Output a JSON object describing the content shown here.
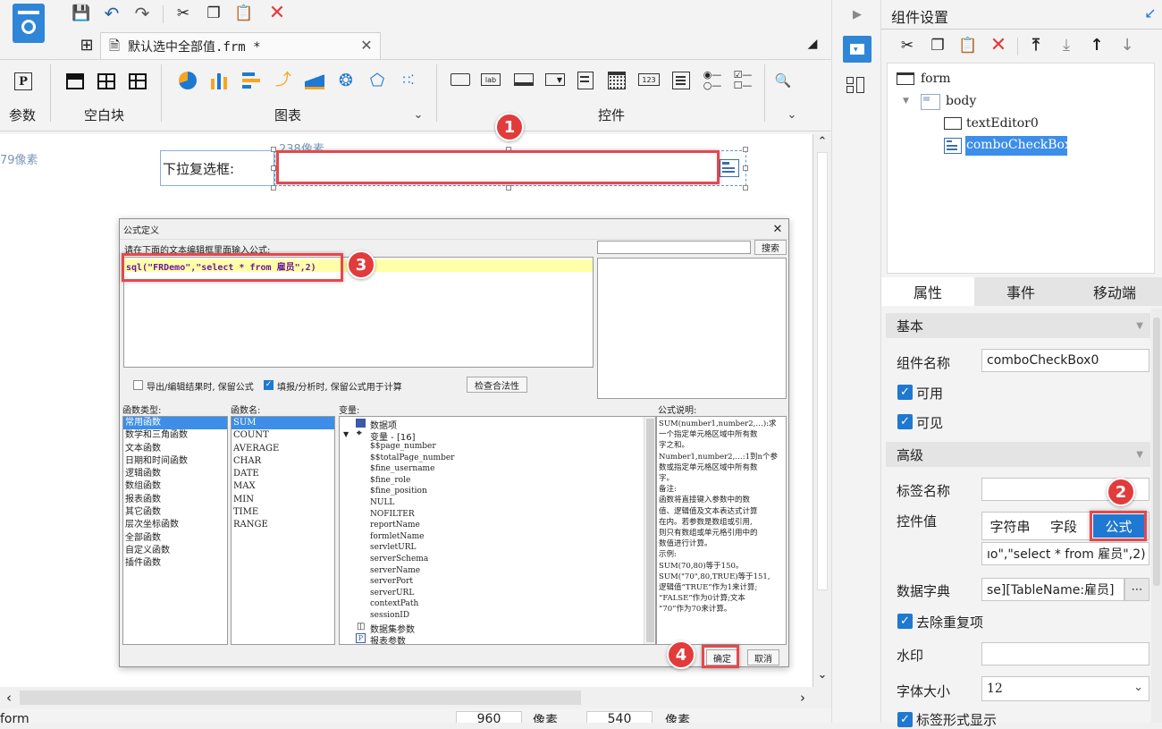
{
  "tab": {
    "title": "默认选中全部值.frm *"
  },
  "ribbon": {
    "groups": [
      {
        "label": "参数"
      },
      {
        "label": "空白块"
      },
      {
        "label": "图表"
      },
      {
        "label": "控件"
      }
    ],
    "control_icon_text": [
      "lab",
      "123"
    ]
  },
  "canvas": {
    "ruler_left": "79像素",
    "ruler_top": "238像素",
    "widget_label": "下拉复选框:"
  },
  "dialog": {
    "title": "公式定义",
    "instruction": "请在下面的文本编辑框里面输入公式:",
    "formula": "sql(\"FRDemo\",\"select * from 雇员\",2)",
    "search_button": "搜索",
    "check_keep_formula": "导出/编辑结果时, 保留公式",
    "check_fill_analysis": "填报/分析时, 保留公式用于计算",
    "check_validity_button": "检查合法性",
    "function_types_label": "函数类型:",
    "function_types": [
      "常用函数",
      "数学和三角函数",
      "文本函数",
      "日期和时间函数",
      "逻辑函数",
      "数组函数",
      "报表函数",
      "其它函数",
      "层次坐标函数",
      "全部函数",
      "自定义函数",
      "插件函数"
    ],
    "function_names_label": "函数名:",
    "function_names": [
      "SUM",
      "COUNT",
      "AVERAGE",
      "CHAR",
      "DATE",
      "MAX",
      "MIN",
      "TIME",
      "RANGE"
    ],
    "variables_label": "变量:",
    "var_data_item": "数据项",
    "var_group": "变量 - [16]",
    "variables": [
      "$$page_number",
      "$$totalPage_number",
      "$fine_username",
      "$fine_role",
      "$fine_position",
      "NULL",
      "NOFILTER",
      "reportName",
      "formletName",
      "servletURL",
      "serverSchema",
      "serverName",
      "serverPort",
      "serverURL",
      "contextPath",
      "sessionID"
    ],
    "var_dataset_params": "数据集参数",
    "var_report_params": "报表参数",
    "description_label": "公式说明:",
    "description_lines": [
      "SUM(number1,number2,…):求",
      "一个指定单元格区域中所有数",
      "字之和。",
      "Number1,number2,…:1到n个参",
      "数或指定单元格区域中所有数",
      "字。",
      "备注:",
      "函数将直接键入参数中的数",
      "值、逻辑值及文本表达式计算",
      "在内。若参数是数组或引用,",
      "则只有数组或单元格引用中的",
      "数值进行计算。",
      "示例:",
      "SUM(70,80)等于150。",
      "SUM(\"70\",80,TRUE)等于151,",
      "逻辑值“TRUE”作为1来计算;",
      "“FALSE”作为0计算;文本",
      "“70”作为70来计算。"
    ],
    "ok_button": "确定",
    "cancel_button": "取消"
  },
  "statusbar": {
    "left": "form",
    "width": "960",
    "unit": "像素",
    "height": "540",
    "unit2": "像素"
  },
  "panel": {
    "title": "组件设置",
    "tree": [
      "form",
      "body",
      "textEditor0",
      "comboCheckBox0"
    ],
    "tabs": [
      "属性",
      "事件",
      "移动端"
    ],
    "section_basic": "基本",
    "component_name_label": "组件名称",
    "component_name_value": "comboCheckBox0",
    "enabled_label": "可用",
    "visible_label": "可见",
    "section_advanced": "高级",
    "tag_name_label": "标签名称",
    "control_value_label": "控件值",
    "value_types": [
      "字符串",
      "字段",
      "公式"
    ],
    "control_value_text": "ıo\",\"select * from 雇员\",2)",
    "data_dict_label": "数据字典",
    "data_dict_value": "se][TableName:雇员]",
    "dedupe_label": "去除重复项",
    "watermark_label": "水印",
    "font_size_label": "字体大小",
    "font_size_value": "12",
    "label_display_label": "标签形式显示"
  },
  "badges": [
    "1",
    "2",
    "3",
    "4"
  ],
  "colors": {
    "accent": "#1f78d1",
    "highlight": "#e5484d",
    "selection": "#3c8ee8"
  }
}
